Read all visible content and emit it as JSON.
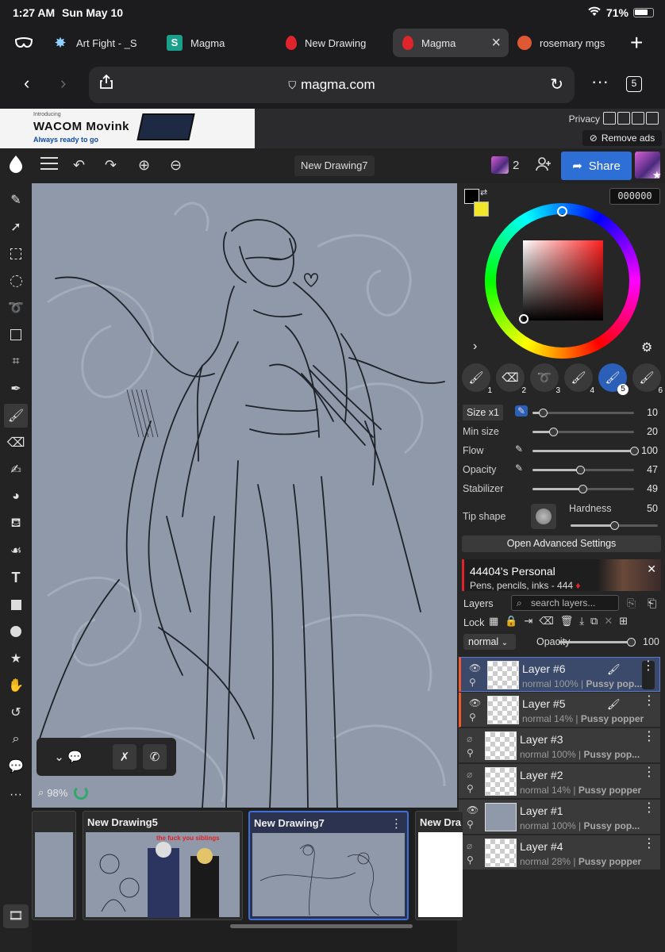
{
  "status": {
    "time": "1:27 AM",
    "date": "Sun May 10",
    "battery": "71%"
  },
  "tabs": [
    {
      "label": "Art Fight - _S"
    },
    {
      "label": "Magma"
    },
    {
      "label": "New Drawing"
    },
    {
      "label": "Magma"
    },
    {
      "label": "rosemary mgs"
    }
  ],
  "urlbar": {
    "url": "magma.com",
    "tab_count": "5"
  },
  "ad": {
    "intro": "Introducing",
    "brand": "WACOM Movink",
    "tagline": "Always ready to go",
    "privacy": "Privacy",
    "remove": "Remove ads"
  },
  "toolbar": {
    "doc_title": "New Drawing7",
    "user_count": "2",
    "share": "Share"
  },
  "color": {
    "hex": "000000",
    "primary": "#000000",
    "secondary": "#f0e62a"
  },
  "brush_presets": [
    "1",
    "2",
    "3",
    "4",
    "5",
    "6"
  ],
  "brush": {
    "size_label": "Size x1",
    "size": "10",
    "size_level": 0.1,
    "minsize_label": "Min size",
    "minsize": "20",
    "minsize_level": 0.2,
    "flow_label": "Flow",
    "flow": "100",
    "flow_level": 1.0,
    "opacity_label": "Opacity",
    "opacity": "47",
    "opacity_level": 0.47,
    "stabilizer_label": "Stabilizer",
    "stabilizer": "49",
    "stabilizer_level": 0.49,
    "tip_label": "Tip shape",
    "hardness_label": "Hardness",
    "hardness": "50",
    "hardness_level": 0.5,
    "advanced": "Open Advanced Settings"
  },
  "banner": {
    "title": "44404's Personal",
    "subtitle": "Pens, pencils, inks - 444"
  },
  "layers_panel": {
    "title": "Layers",
    "search_placeholder": "search layers...",
    "lock_label": "Lock",
    "blend": "normal",
    "opacity_label": "Opacity",
    "opacity": "100",
    "opacity_level": 1.0
  },
  "layers": [
    {
      "name": "Layer #6",
      "meta": "normal 100% | ",
      "owner": "Pussy pop...",
      "active": true
    },
    {
      "name": "Layer #5",
      "meta": "normal 14% | ",
      "owner": "Pussy popper",
      "active": false
    },
    {
      "name": "Layer #3",
      "meta": "normal 100% | ",
      "owner": "Pussy pop...",
      "active": false
    },
    {
      "name": "Layer #2",
      "meta": "normal 14% | ",
      "owner": "Pussy popper",
      "active": false
    },
    {
      "name": "Layer #1",
      "meta": "normal 100% | ",
      "owner": "Pussy pop...",
      "active": false
    },
    {
      "name": "Layer #4",
      "meta": "normal 28% | ",
      "owner": "Pussy popper",
      "active": false
    }
  ],
  "canvas": {
    "zoom": "98%"
  },
  "drawings": [
    {
      "title": "New Drawing5",
      "caption": "the fuck you siblings"
    },
    {
      "title": "New Drawing7"
    },
    {
      "title": "New Dra"
    }
  ]
}
